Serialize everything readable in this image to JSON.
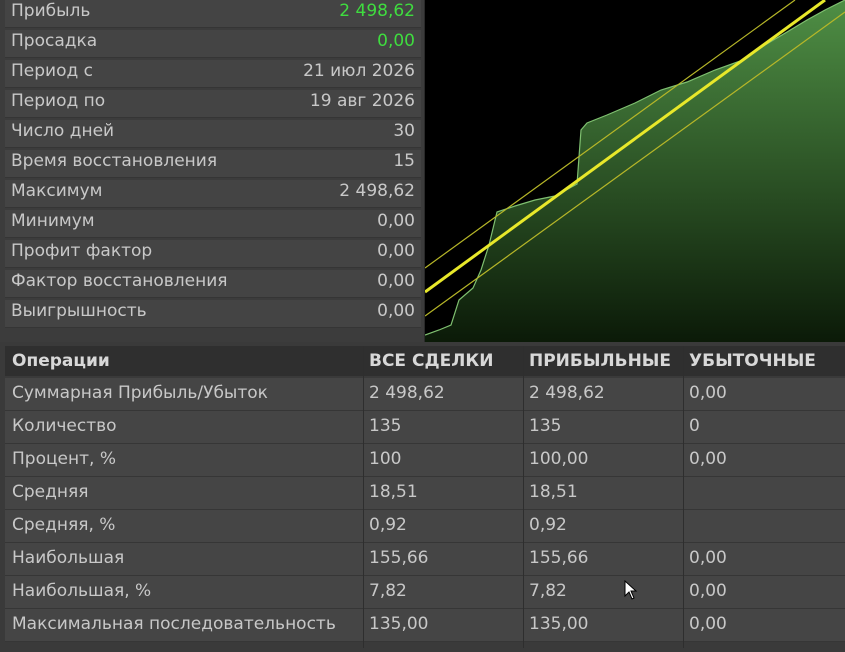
{
  "stats": [
    {
      "label": "Прибыль",
      "value": "2 498,62",
      "highlight": true
    },
    {
      "label": "Просадка",
      "value": "0,00",
      "highlight": true
    },
    {
      "label": "Период с",
      "value": "21 июл 2026",
      "highlight": false
    },
    {
      "label": "Период по",
      "value": "19 авг 2026",
      "highlight": false
    },
    {
      "label": "Число дней",
      "value": "30",
      "highlight": false
    },
    {
      "label": "Время восстановления",
      "value": "15",
      "highlight": false
    },
    {
      "label": "Максимум",
      "value": "2 498,62",
      "highlight": false
    },
    {
      "label": "Минимум",
      "value": "0,00",
      "highlight": false
    },
    {
      "label": "Профит фактор",
      "value": "0,00",
      "highlight": false
    },
    {
      "label": "Фактор восстановления",
      "value": "0,00",
      "highlight": false
    },
    {
      "label": "Выигрышность",
      "value": "0,00",
      "highlight": false
    }
  ],
  "table": {
    "headers": [
      "Операции",
      "ВСЕ СДЕЛКИ",
      "ПРИБЫЛЬНЫЕ",
      "УБЫТОЧНЫЕ"
    ],
    "rows": [
      [
        "Суммарная Прибыль/Убыток",
        "2 498,62",
        "2 498,62",
        "0,00"
      ],
      [
        "Количество",
        "135",
        "135",
        "0"
      ],
      [
        "Процент, %",
        "100",
        "100,00",
        "0,00"
      ],
      [
        "Средняя",
        "18,51",
        "18,51",
        ""
      ],
      [
        "Средняя, %",
        "0,92",
        "0,92",
        ""
      ],
      [
        "Наибольшая",
        "155,66",
        "155,66",
        "0,00"
      ],
      [
        "Наибольшая, %",
        "7,82",
        "7,82",
        "0,00"
      ],
      [
        "Максимальная последовательность",
        "135,00",
        "135,00",
        "0,00"
      ]
    ]
  },
  "colors": {
    "positive": "#3fdc3f",
    "equity_fill": "#3f7a35",
    "trend_line": "#e8e82a"
  }
}
